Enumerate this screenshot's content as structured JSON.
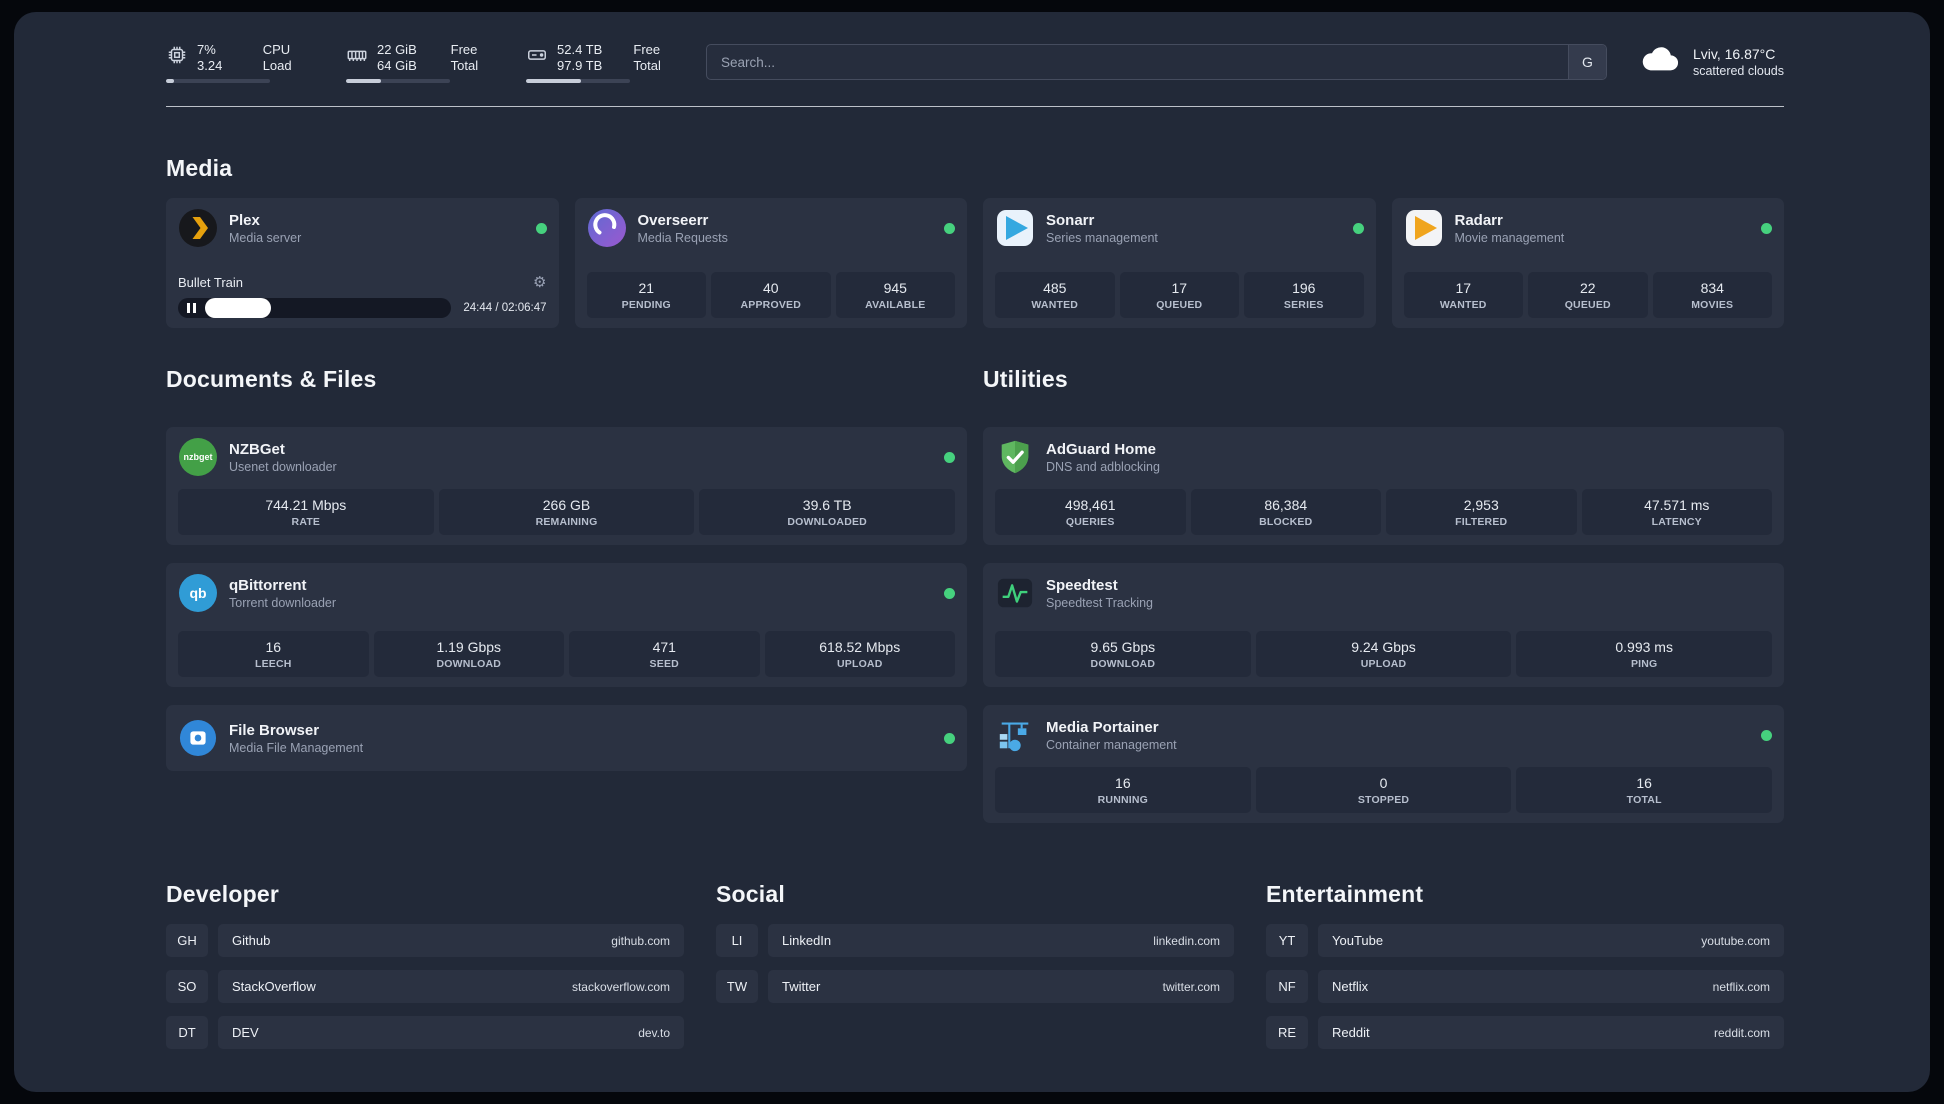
{
  "icons": {
    "gear": "⚙"
  },
  "topbar": {
    "cpu": {
      "v1": "7%",
      "l1": "CPU",
      "v2": "3.24",
      "l2": "Load",
      "bar_style": "width:8%"
    },
    "ram": {
      "v1": "22 GiB",
      "l1": "Free",
      "v2": "64 GiB",
      "l2": "Total",
      "bar_style": "width:34%"
    },
    "disk": {
      "v1": "52.4 TB",
      "l1": "Free",
      "v2": "97.9 TB",
      "l2": "Total",
      "bar_style": "width:53%"
    },
    "search": {
      "placeholder": "Search...",
      "button": "G"
    },
    "weather": {
      "location": "Lviv, 16.87°C",
      "condition": "scattered clouds"
    }
  },
  "media": {
    "heading": "Media",
    "plex": {
      "title": "Plex",
      "subtitle": "Media server",
      "now_playing": "Bullet Train",
      "time": "24:44 / 02:06:47",
      "progress_style": "width:24%"
    },
    "overseerr": {
      "title": "Overseerr",
      "subtitle": "Media Requests",
      "stats": [
        {
          "value": "21",
          "label": "PENDING"
        },
        {
          "value": "40",
          "label": "APPROVED"
        },
        {
          "value": "945",
          "label": "AVAILABLE"
        }
      ]
    },
    "sonarr": {
      "title": "Sonarr",
      "subtitle": "Series management",
      "stats": [
        {
          "value": "485",
          "label": "WANTED"
        },
        {
          "value": "17",
          "label": "QUEUED"
        },
        {
          "value": "196",
          "label": "SERIES"
        }
      ]
    },
    "radarr": {
      "title": "Radarr",
      "subtitle": "Movie management",
      "stats": [
        {
          "value": "17",
          "label": "WANTED"
        },
        {
          "value": "22",
          "label": "QUEUED"
        },
        {
          "value": "834",
          "label": "MOVIES"
        }
      ]
    }
  },
  "docs": {
    "heading": "Documents & Files",
    "nzbget": {
      "title": "NZBGet",
      "subtitle": "Usenet downloader",
      "icon_text": "nzbget",
      "stats": [
        {
          "value": "744.21 Mbps",
          "label": "RATE"
        },
        {
          "value": "266 GB",
          "label": "REMAINING"
        },
        {
          "value": "39.6 TB",
          "label": "DOWNLOADED"
        }
      ]
    },
    "qbittorrent": {
      "title": "qBittorrent",
      "subtitle": "Torrent downloader",
      "icon_text": "qb",
      "stats": [
        {
          "value": "16",
          "label": "LEECH"
        },
        {
          "value": "1.19 Gbps",
          "label": "DOWNLOAD"
        },
        {
          "value": "471",
          "label": "SEED"
        },
        {
          "value": "618.52 Mbps",
          "label": "UPLOAD"
        }
      ]
    },
    "filebrowser": {
      "title": "File Browser",
      "subtitle": "Media File Management"
    }
  },
  "utilities": {
    "heading": "Utilities",
    "adguard": {
      "title": "AdGuard Home",
      "subtitle": "DNS and adblocking",
      "stats": [
        {
          "value": "498,461",
          "label": "QUERIES"
        },
        {
          "value": "86,384",
          "label": "BLOCKED"
        },
        {
          "value": "2,953",
          "label": "FILTERED"
        },
        {
          "value": "47.571 ms",
          "label": "LATENCY"
        }
      ]
    },
    "speedtest": {
      "title": "Speedtest",
      "subtitle": "Speedtest Tracking",
      "stats": [
        {
          "value": "9.65 Gbps",
          "label": "DOWNLOAD"
        },
        {
          "value": "9.24 Gbps",
          "label": "UPLOAD"
        },
        {
          "value": "0.993 ms",
          "label": "PING"
        }
      ]
    },
    "portainer": {
      "title": "Media Portainer",
      "subtitle": "Container management",
      "stats": [
        {
          "value": "16",
          "label": "RUNNING"
        },
        {
          "value": "0",
          "label": "STOPPED"
        },
        {
          "value": "16",
          "label": "TOTAL"
        }
      ]
    }
  },
  "bookmarks": {
    "developer": {
      "heading": "Developer",
      "items": [
        {
          "abbr": "GH",
          "name": "Github",
          "url": "github.com"
        },
        {
          "abbr": "SO",
          "name": "StackOverflow",
          "url": "stackoverflow.com"
        },
        {
          "abbr": "DT",
          "name": "DEV",
          "url": "dev.to"
        }
      ]
    },
    "social": {
      "heading": "Social",
      "items": [
        {
          "abbr": "LI",
          "name": "LinkedIn",
          "url": "linkedin.com"
        },
        {
          "abbr": "TW",
          "name": "Twitter",
          "url": "twitter.com"
        }
      ]
    },
    "entertainment": {
      "heading": "Entertainment",
      "items": [
        {
          "abbr": "YT",
          "name": "YouTube",
          "url": "youtube.com"
        },
        {
          "abbr": "NF",
          "name": "Netflix",
          "url": "netflix.com"
        },
        {
          "abbr": "RE",
          "name": "Reddit",
          "url": "reddit.com"
        }
      ]
    }
  }
}
